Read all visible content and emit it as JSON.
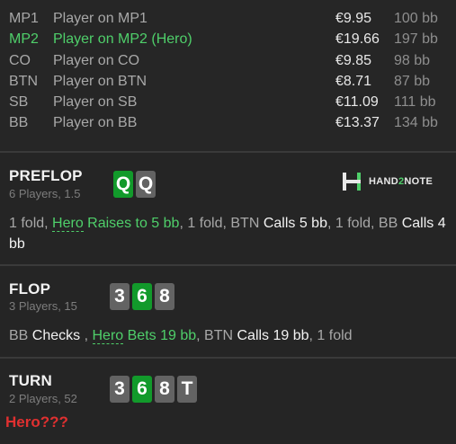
{
  "players": [
    {
      "pos": "MP1",
      "name": "Player on MP1",
      "stack": "€9.95",
      "bb": "100 bb",
      "hero": false
    },
    {
      "pos": "MP2",
      "name": "Player on MP2 (Hero)",
      "stack": "€19.66",
      "bb": "197 bb",
      "hero": true
    },
    {
      "pos": "CO",
      "name": "Player on CO",
      "stack": "€9.85",
      "bb": "98 bb",
      "hero": false
    },
    {
      "pos": "BTN",
      "name": "Player on BTN",
      "stack": "€8.71",
      "bb": "87 bb",
      "hero": false
    },
    {
      "pos": "SB",
      "name": "Player on SB",
      "stack": "€11.09",
      "bb": "111 bb",
      "hero": false
    },
    {
      "pos": "BB",
      "name": "Player on BB",
      "stack": "€13.37",
      "bb": "134 bb",
      "hero": false
    }
  ],
  "logo": {
    "main": "HAND",
    "two": "2",
    "tail": "NOTE",
    "accent": "#4fcf6a"
  },
  "preflop": {
    "title": "PREFLOP",
    "info": "6 Players, 1.5",
    "cards": [
      {
        "rank": "Q",
        "color": "green"
      },
      {
        "rank": "Q",
        "color": "gray"
      }
    ],
    "actions": [
      {
        "t": "1 fold, ",
        "s": "n"
      },
      {
        "t": "Hero",
        "s": "hn"
      },
      {
        "t": " Raises to 5 bb",
        "s": "h"
      },
      {
        "t": ", 1 fold, BTN ",
        "s": "n"
      },
      {
        "t": "Calls 5 bb",
        "s": "b"
      },
      {
        "t": ", 1 fold, BB ",
        "s": "n"
      },
      {
        "t": "Calls 4 bb",
        "s": "b"
      }
    ]
  },
  "flop": {
    "title": "FLOP",
    "info": "3 Players, 15",
    "cards": [
      {
        "rank": "3",
        "color": "gray"
      },
      {
        "rank": "6",
        "color": "green"
      },
      {
        "rank": "8",
        "color": "gray"
      }
    ],
    "actions": [
      {
        "t": "BB ",
        "s": "n"
      },
      {
        "t": "Checks",
        "s": "b"
      },
      {
        "t": " , ",
        "s": "n"
      },
      {
        "t": "Hero",
        "s": "hn"
      },
      {
        "t": " Bets 19 bb",
        "s": "h"
      },
      {
        "t": ", BTN ",
        "s": "n"
      },
      {
        "t": "Calls 19 bb",
        "s": "b"
      },
      {
        "t": ", 1 fold",
        "s": "n"
      }
    ]
  },
  "turn": {
    "title": "TURN",
    "info": "2 Players, 52",
    "cards": [
      {
        "rank": "3",
        "color": "gray"
      },
      {
        "rank": "6",
        "color": "green"
      },
      {
        "rank": "8",
        "color": "gray"
      },
      {
        "rank": "T",
        "color": "gray"
      }
    ]
  },
  "question": "Hero???"
}
